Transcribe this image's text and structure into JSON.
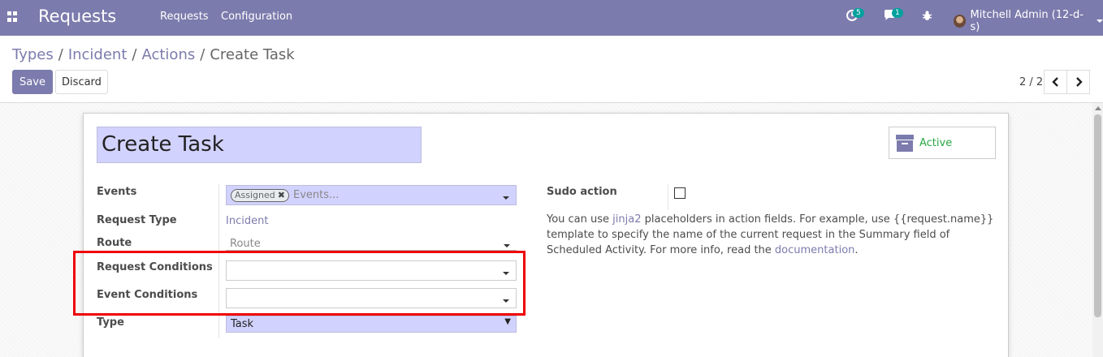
{
  "navbar": {
    "app_title": "Requests",
    "menu": [
      "Requests",
      "Configuration"
    ],
    "activity_count": "5",
    "message_count": "1",
    "user_name": "Mitchell Admin (12-d-s)"
  },
  "breadcrumb": {
    "items": [
      "Types",
      "Incident",
      "Actions"
    ],
    "current": "Create Task"
  },
  "buttons": {
    "save": "Save",
    "discard": "Discard"
  },
  "pager": {
    "value": "2 / 2"
  },
  "form": {
    "name": "Create Task",
    "active_label": "Active",
    "labels": {
      "events": "Events",
      "request_type": "Request Type",
      "route": "Route",
      "request_conditions": "Request Conditions",
      "event_conditions": "Event Conditions",
      "type": "Type",
      "sudo_action": "Sudo action"
    },
    "events_tag": "Assigned",
    "events_placeholder": "Events...",
    "request_type_value": "Incident",
    "route_placeholder": "Route",
    "request_conditions_value": "",
    "event_conditions_value": "",
    "type_value": "Task",
    "help": {
      "part1": "You can use ",
      "link1": "jinja2",
      "part2": " placeholders in action fields. For example, use {{request.name}} template to specify the name of the current request in the Summary field of Scheduled Activity. For more info, read the ",
      "link2": "documentation",
      "part3": "."
    }
  },
  "colors": {
    "brand": "#7c7bad",
    "required_bg": "#d2d2ff",
    "highlight": "#e00000",
    "active": "#28a745"
  }
}
